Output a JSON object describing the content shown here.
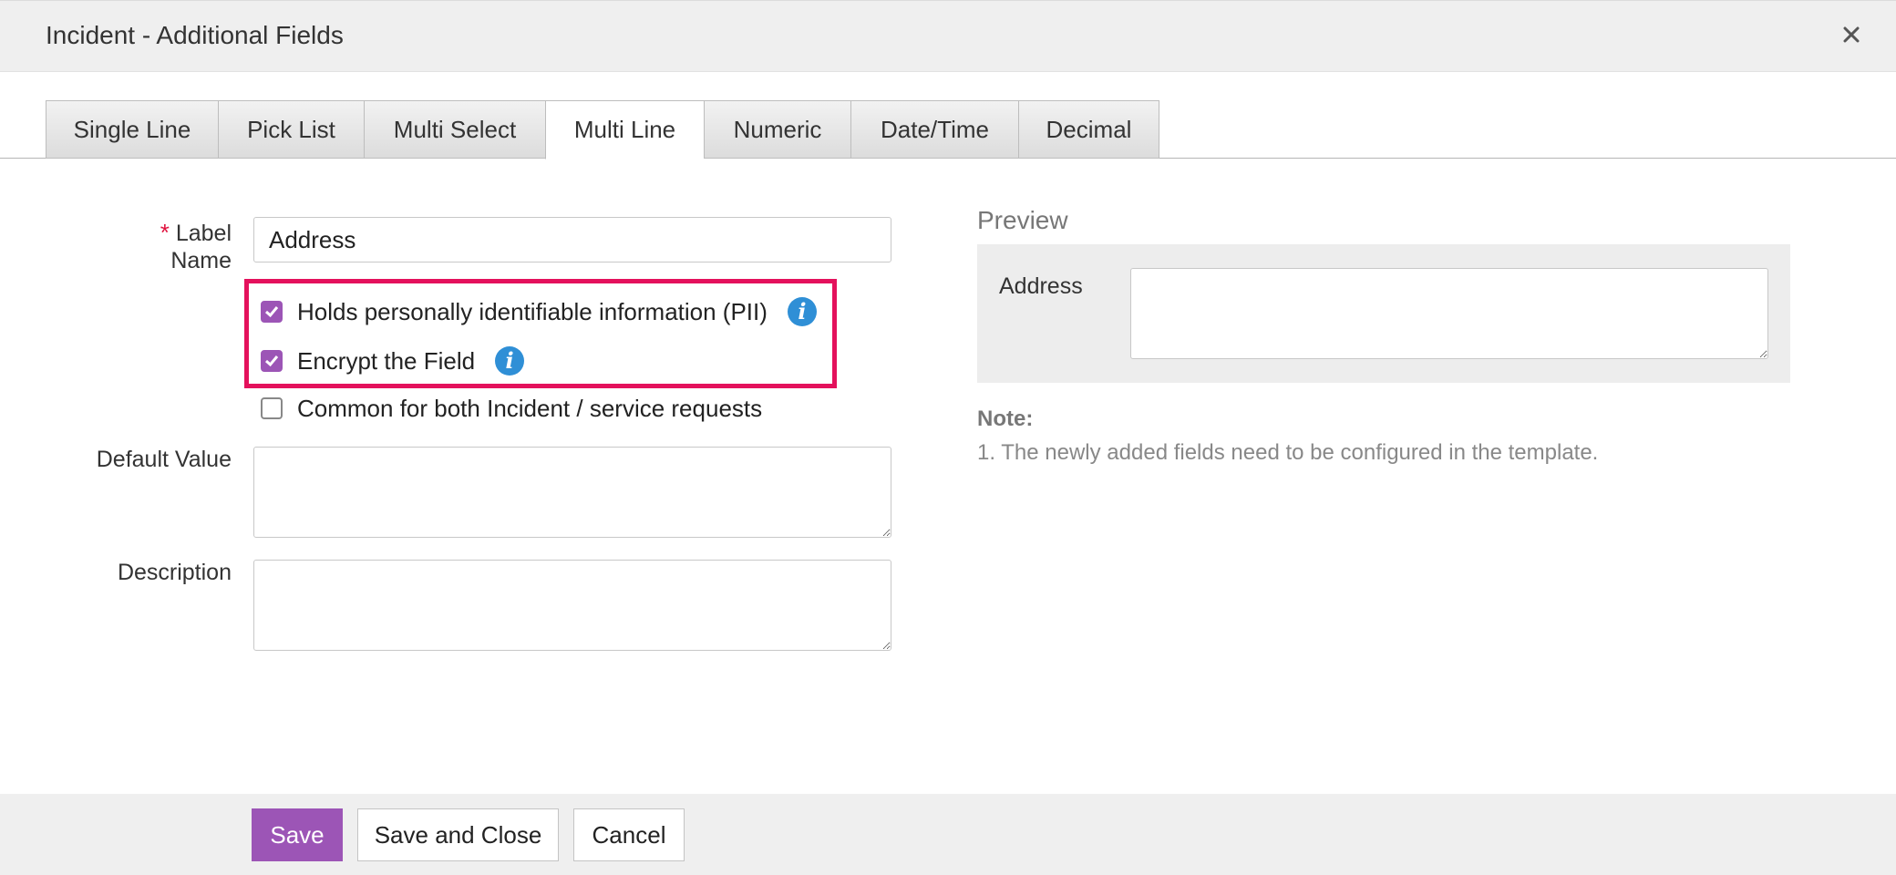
{
  "dialog": {
    "title": "Incident - Additional Fields"
  },
  "tabs": [
    {
      "label": "Single Line"
    },
    {
      "label": "Pick List"
    },
    {
      "label": "Multi Select"
    },
    {
      "label": "Multi Line",
      "active": true
    },
    {
      "label": "Numeric"
    },
    {
      "label": "Date/Time"
    },
    {
      "label": "Decimal"
    }
  ],
  "form": {
    "label_name": {
      "required_marker": "*",
      "label_line1": "Label",
      "label_line2": "Name",
      "value": "Address"
    },
    "pii_checkbox": {
      "label": "Holds personally identifiable information (PII)",
      "checked": true,
      "info_icon": "info-icon"
    },
    "encrypt_checkbox": {
      "label": "Encrypt the Field",
      "checked": true,
      "info_icon": "info-icon"
    },
    "common_checkbox": {
      "label": "Common for both Incident / service requests",
      "checked": false
    },
    "default_value": {
      "label": "Default Value",
      "value": ""
    },
    "description": {
      "label": "Description",
      "value": ""
    }
  },
  "preview": {
    "title": "Preview",
    "field_label": "Address",
    "field_value": ""
  },
  "note": {
    "title": "Note:",
    "text": "1. The newly added fields need to be configured in the template."
  },
  "footer": {
    "save_label": "Save",
    "save_close_label": "Save and Close",
    "cancel_label": "Cancel"
  },
  "colors": {
    "accent": "#9c55b6",
    "highlight": "#e4115c",
    "info": "#2f8fd6",
    "required": "#e0123e"
  }
}
